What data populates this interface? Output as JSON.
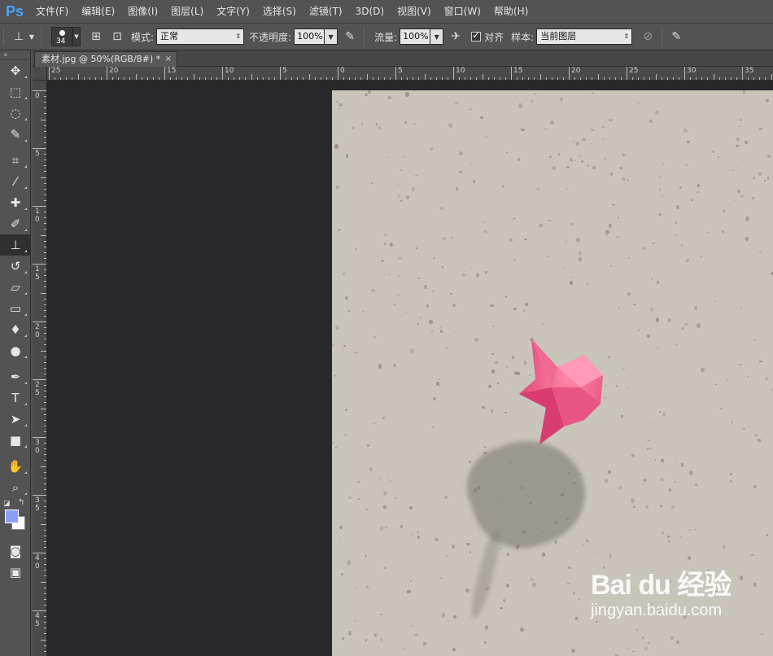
{
  "app": {
    "logo": "Ps"
  },
  "menu": [
    "文件(F)",
    "编辑(E)",
    "图像(I)",
    "图层(L)",
    "文字(Y)",
    "选择(S)",
    "滤镜(T)",
    "3D(D)",
    "视图(V)",
    "窗口(W)",
    "帮助(H)"
  ],
  "options": {
    "brush_size": "34",
    "mode_label": "模式:",
    "mode_value": "正常",
    "opacity_label": "不透明度:",
    "opacity_value": "100%",
    "flow_label": "流量:",
    "flow_value": "100%",
    "align_label": "对齐",
    "align_checked": true,
    "sample_label": "样本:",
    "sample_value": "当前图层"
  },
  "document": {
    "tab_title": "素材.jpg @ 50%(RGB/8#) *",
    "close": "×"
  },
  "ruler_h_labels": [
    "25",
    "20",
    "15",
    "10",
    "5",
    "0",
    "5",
    "10",
    "15",
    "20",
    "25",
    "30",
    "35"
  ],
  "ruler_v_labels": [
    "0",
    "5",
    "1\n0",
    "1\n5",
    "2\n0",
    "2\n5",
    "3\n0",
    "3\n5",
    "4\n0",
    "4\n5"
  ],
  "tools": [
    {
      "name": "move-tool-icon",
      "glyph": "✥"
    },
    {
      "name": "marquee-tool-icon",
      "glyph": "⬚"
    },
    {
      "name": "lasso-tool-icon",
      "glyph": "◌"
    },
    {
      "name": "quick-select-tool-icon",
      "glyph": "✎"
    },
    {
      "name": "crop-tool-icon",
      "glyph": "⌗"
    },
    {
      "name": "eyedropper-tool-icon",
      "glyph": "⁄"
    },
    {
      "name": "healing-brush-tool-icon",
      "glyph": "✚"
    },
    {
      "name": "brush-tool-icon",
      "glyph": "✐"
    },
    {
      "name": "clone-stamp-tool-icon",
      "glyph": "⊥"
    },
    {
      "name": "history-brush-tool-icon",
      "glyph": "↺"
    },
    {
      "name": "eraser-tool-icon",
      "glyph": "▱"
    },
    {
      "name": "gradient-tool-icon",
      "glyph": "▭"
    },
    {
      "name": "blur-tool-icon",
      "glyph": "♦"
    },
    {
      "name": "dodge-tool-icon",
      "glyph": "●"
    },
    {
      "name": "pen-tool-icon",
      "glyph": "✒"
    },
    {
      "name": "type-tool-icon",
      "glyph": "T"
    },
    {
      "name": "path-select-tool-icon",
      "glyph": "➤"
    },
    {
      "name": "rectangle-tool-icon",
      "glyph": "■"
    },
    {
      "name": "hand-tool-icon",
      "glyph": "✋"
    },
    {
      "name": "zoom-tool-icon",
      "glyph": "⌕"
    }
  ],
  "colors": {
    "foreground": "#8b9ff4",
    "background": "#ffffff"
  },
  "watermark": {
    "logo_text": "Bai du 经验",
    "url": "jingyan.baidu.com"
  }
}
